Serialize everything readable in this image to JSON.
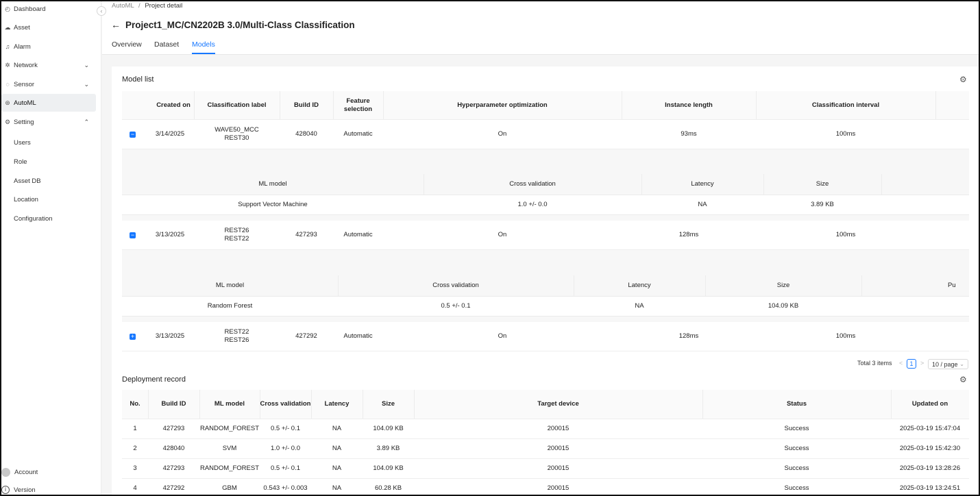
{
  "sidebar": {
    "items": [
      {
        "label": "Dashboard",
        "icon": "dashboard-icon"
      },
      {
        "label": "Asset",
        "icon": "asset-icon"
      },
      {
        "label": "Alarm",
        "icon": "bell-icon"
      },
      {
        "label": "Network",
        "icon": "network-icon"
      },
      {
        "label": "Sensor",
        "icon": "sensor-icon"
      },
      {
        "label": "AutoML",
        "icon": "automl-icon"
      },
      {
        "label": "Setting",
        "icon": "gear-icon"
      }
    ],
    "sub_items": [
      "Users",
      "Role",
      "Asset DB",
      "Location",
      "Configuration"
    ],
    "account_label": "Account",
    "version_label": "Version"
  },
  "header": {
    "breadcrumb_root": "AutoML",
    "breadcrumb_sep": "/",
    "breadcrumb_current": "Project detail",
    "title": "Project1_MC/CN2202B 3.0/Multi-Class Classification",
    "tabs": [
      "Overview",
      "Dataset",
      "Models"
    ],
    "active_tab": "Models"
  },
  "model_list": {
    "title": "Model list",
    "columns": [
      "Created on",
      "Classification label",
      "Build ID",
      "Feature selection",
      "Hyperparameter optimization",
      "Instance length",
      "Classification interval"
    ],
    "rows": [
      {
        "created": "3/14/2025",
        "label1": "WAVE50_MCC",
        "label2": "REST30",
        "build_id": "428040",
        "feature": "Automatic",
        "hyper": "On",
        "instance": "93ms",
        "interval": "100ms",
        "toggle": "−"
      },
      {
        "created": "3/13/2025",
        "label1": "REST26",
        "label2": "REST22",
        "build_id": "427293",
        "feature": "Automatic",
        "hyper": "On",
        "instance": "128ms",
        "interval": "100ms",
        "toggle": "−"
      },
      {
        "created": "3/13/2025",
        "label1": "REST22",
        "label2": "REST26",
        "build_id": "427292",
        "feature": "Automatic",
        "hyper": "On",
        "instance": "128ms",
        "interval": "100ms",
        "toggle": "+"
      }
    ],
    "sub_columns": [
      "ML model",
      "Cross validation",
      "Latency",
      "Size",
      "Pu"
    ],
    "sub_rows": [
      {
        "model": "Support Vector Machine",
        "cv": "1.0 +/- 0.0",
        "latency": "NA",
        "size": "3.89 KB"
      },
      {
        "model": "Random Forest",
        "cv": "0.5 +/- 0.1",
        "latency": "NA",
        "size": "104.09 KB"
      }
    ],
    "total": "Total 3 items",
    "page": "1",
    "prev": "<",
    "next": ">",
    "page_size": "10 / page"
  },
  "deployment": {
    "title": "Deployment record",
    "columns": [
      "No.",
      "Build ID",
      "ML model",
      "Cross validation",
      "Latency",
      "Size",
      "Target device",
      "Status",
      "Updated on"
    ],
    "rows": [
      {
        "no": "1",
        "build_id": "427293",
        "model": "RANDOM_FOREST",
        "cv": "0.5 +/- 0.1",
        "latency": "NA",
        "size": "104.09 KB",
        "device": "200015",
        "status": "Success",
        "updated": "2025-03-19 15:47:04"
      },
      {
        "no": "2",
        "build_id": "428040",
        "model": "SVM",
        "cv": "1.0 +/- 0.0",
        "latency": "NA",
        "size": "3.89 KB",
        "device": "200015",
        "status": "Success",
        "updated": "2025-03-19 15:42:30"
      },
      {
        "no": "3",
        "build_id": "427293",
        "model": "RANDOM_FOREST",
        "cv": "0.5 +/- 0.1",
        "latency": "NA",
        "size": "104.09 KB",
        "device": "200015",
        "status": "Success",
        "updated": "2025-03-19 13:28:26"
      },
      {
        "no": "4",
        "build_id": "427292",
        "model": "GBM",
        "cv": "0.543 +/- 0.003",
        "latency": "NA",
        "size": "60.28 KB",
        "device": "200015",
        "status": "Success",
        "updated": "2025-03-19 13:24:51"
      }
    ]
  },
  "colors": {
    "accent": "#1677ff"
  }
}
